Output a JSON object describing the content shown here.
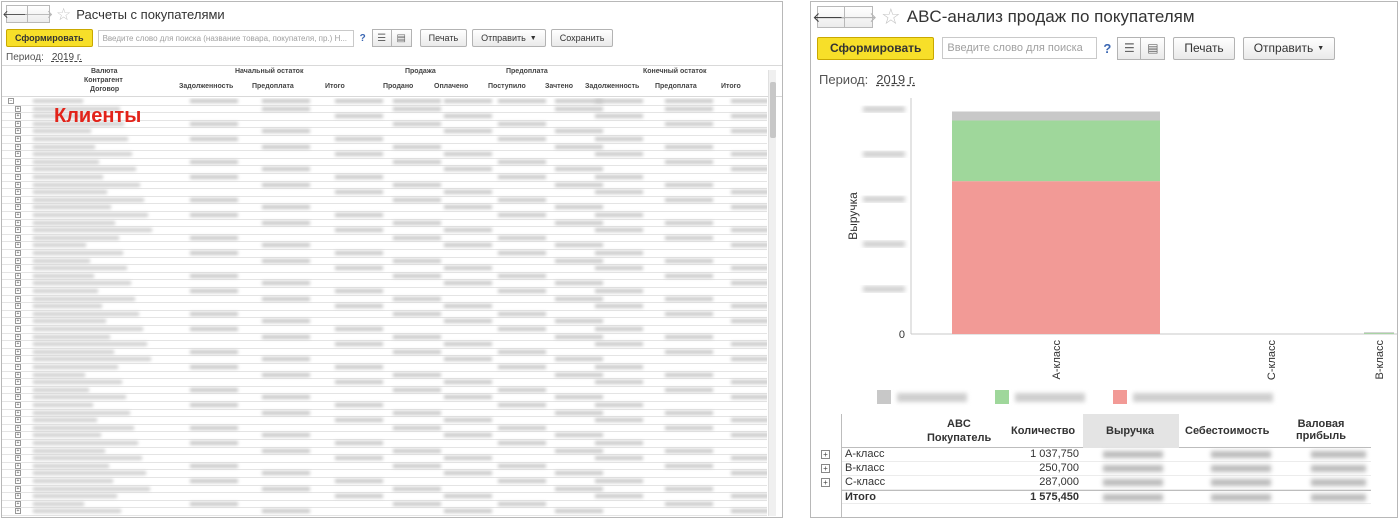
{
  "left": {
    "title": "Расчеты с покупателями",
    "toolbar": {
      "generate_label": "Сформировать",
      "search_placeholder": "Введите слово для поиска (название товара, покупателя, пр.)  Н...",
      "help": "?",
      "print_label": "Печать",
      "send_label": "Отправить",
      "save_label": "Сохранить"
    },
    "period": {
      "label": "Период:",
      "value": "2019 г."
    },
    "columns": {
      "valuta": "Валюта",
      "kontragent": "Контрагент",
      "dogovor": "Договор",
      "opening": "Начальный остаток",
      "sale": "Продажа",
      "prepay": "Предоплата",
      "closing": "Конечный остаток",
      "debt1": "Задолженность",
      "prepay1": "Предоплата",
      "total1": "Итого",
      "sold": "Продано",
      "paid": "Оплачено",
      "received": "Поступило",
      "credited": "Зачтено",
      "debt2": "Задолженность",
      "prepay2": "Предоплата",
      "total2": "Итого"
    },
    "overlay_label": "Клиенты"
  },
  "right": {
    "title": "ABC-анализ продаж по покупателям",
    "toolbar": {
      "generate_label": "Сформировать",
      "search_placeholder": "Введите слово для поиска",
      "help": "?",
      "print_label": "Печать",
      "send_label": "Отправить"
    },
    "period": {
      "label": "Период:",
      "value": "2019 г."
    },
    "table": {
      "header_abc": "ABC",
      "header_buyer": "Покупатель",
      "header_qty": "Количество",
      "header_revenue": "Выручка",
      "header_cost": "Себестоимость",
      "header_profit": "Валовая прибыль",
      "rows": [
        {
          "cat": "A-класс",
          "qty": "1 037,750"
        },
        {
          "cat": "B-класс",
          "qty": "250,700"
        },
        {
          "cat": "C-класс",
          "qty": "287,000"
        }
      ],
      "total": {
        "cat": "Итого",
        "qty": "1 575,450"
      }
    },
    "legend_colors": [
      "#c8c8c8",
      "#9fd79b",
      "#f29a96"
    ]
  },
  "chart_data": {
    "type": "bar",
    "stacked": true,
    "categories": [
      "A-класс",
      "C-класс",
      "B-класс"
    ],
    "ylabel": "Выручка",
    "yticks_visible": [
      "0"
    ],
    "series": [
      {
        "color": "#f29a96",
        "values": [
          0.68,
          0,
          0
        ]
      },
      {
        "color": "#9fd79b",
        "values": [
          0.27,
          0,
          0.005
        ]
      },
      {
        "color": "#c8c8c8",
        "values": [
          0.04,
          0,
          0.003
        ]
      }
    ],
    "ylim": [
      0,
      1.05
    ]
  }
}
